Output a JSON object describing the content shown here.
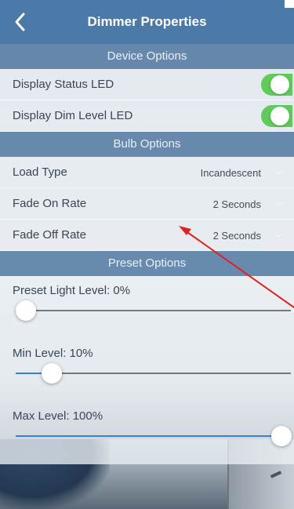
{
  "nav": {
    "title": "Dimmer Properties",
    "back_icon": "chevron-left-icon"
  },
  "sections": {
    "device": "Device Options",
    "bulb": "Bulb Options",
    "preset": "Preset Options"
  },
  "device_options": [
    {
      "label": "Display Status LED",
      "on": true
    },
    {
      "label": "Display Dim Level LED",
      "on": true
    }
  ],
  "bulb_options": [
    {
      "label": "Load Type",
      "value": "Incandescent"
    },
    {
      "label": "Fade On Rate",
      "value": "2 Seconds"
    },
    {
      "label": "Fade Off Rate",
      "value": "2 Seconds"
    }
  ],
  "preset_options": [
    {
      "label": "Preset Light Level: 0%",
      "level": 0
    },
    {
      "label": "Min Level: 10%",
      "level": 10
    },
    {
      "label": "Max Level: 100%",
      "level": 100
    }
  ],
  "colors": {
    "nav_bar": "#4c7aa8",
    "section_header": "#5c81a8",
    "toggle_on": "#5ecb5a",
    "slider_fill": "#3a7ed8",
    "annotation_arrow": "#e02020"
  }
}
